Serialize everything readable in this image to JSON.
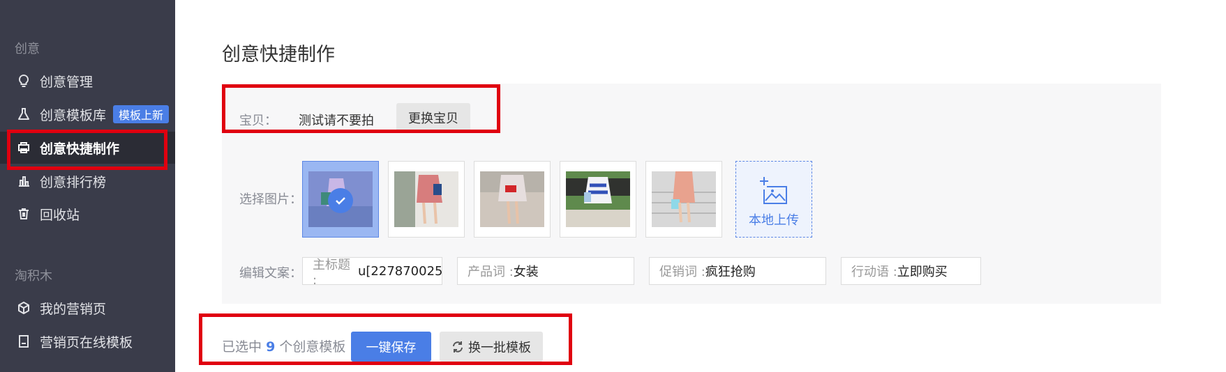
{
  "sidebar": {
    "section1": "创意",
    "items": [
      {
        "label": "创意管理"
      },
      {
        "label": "创意模板库",
        "badge": "模板上新"
      },
      {
        "label": "创意快捷制作"
      },
      {
        "label": "创意排行榜"
      },
      {
        "label": "回收站"
      }
    ],
    "section2": "淘积木",
    "items2": [
      {
        "label": "我的营销页"
      },
      {
        "label": "营销页在线模板"
      }
    ]
  },
  "main": {
    "title": "创意快捷制作",
    "baby_label": "宝贝：",
    "baby_value": "测试请不要拍",
    "change_button": "更换宝贝",
    "select_images_label": "选择图片：",
    "upload_label": "本地上传",
    "copy_label": "编辑文案：",
    "fields": [
      {
        "prefix": "主标题 :",
        "value": "u[227870025"
      },
      {
        "prefix": "产品词 :",
        "value": "女装"
      },
      {
        "prefix": "促销词 :",
        "value": "疯狂抢购"
      },
      {
        "prefix": "行动语 :",
        "value": "立即购买"
      }
    ],
    "selected_prefix": "已选中",
    "selected_count": "9",
    "selected_suffix": "个创意模板",
    "save_button": "一键保存",
    "swap_button": "换一批模板"
  },
  "colors": {
    "accent": "#4a7ee6",
    "highlight": "#e0000f",
    "sidebar": "#3a3c4a"
  }
}
